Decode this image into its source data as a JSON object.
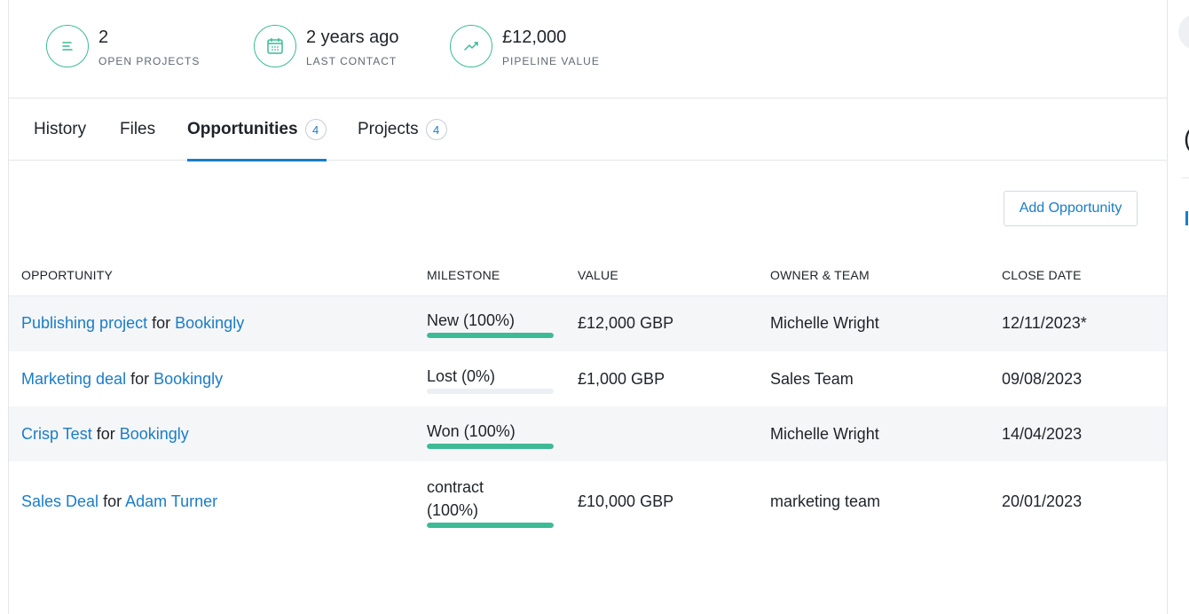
{
  "stats": [
    {
      "value": "2",
      "label": "OPEN PROJECTS",
      "icon": "lines-icon"
    },
    {
      "value": "2 years ago",
      "label": "LAST CONTACT",
      "icon": "calendar-icon"
    },
    {
      "value": "£12,000",
      "label": "PIPELINE VALUE",
      "icon": "trend-icon"
    }
  ],
  "tabs": [
    {
      "label": "History",
      "count": null
    },
    {
      "label": "Files",
      "count": null
    },
    {
      "label": "Opportunities",
      "count": "4"
    },
    {
      "label": "Projects",
      "count": "4"
    }
  ],
  "add_button": "Add Opportunity",
  "table": {
    "headers": [
      "OPPORTUNITY",
      "MILESTONE",
      "VALUE",
      "OWNER & TEAM",
      "CLOSE DATE"
    ],
    "rows": [
      {
        "name": "Publishing project",
        "for": "for",
        "org": "Bookingly",
        "milestone_line1": "New (100%)",
        "milestone_line2": "",
        "progress": 1.0,
        "value": "£12,000 GBP",
        "owner": "Michelle Wright",
        "close": "12/11/2023*"
      },
      {
        "name": "Marketing deal",
        "for": "for",
        "org": "Bookingly",
        "milestone_line1": "Lost (0%)",
        "milestone_line2": "",
        "progress": 0.0,
        "value": "£1,000 GBP",
        "owner": "Sales Team",
        "close": "09/08/2023"
      },
      {
        "name": "Crisp Test",
        "for": "for",
        "org": "Bookingly",
        "milestone_line1": "Won (100%)",
        "milestone_line2": "",
        "progress": 1.0,
        "value": "",
        "owner": "Michelle Wright",
        "close": "14/04/2023"
      },
      {
        "name": "Sales Deal",
        "for": "for",
        "org": "Adam Turner",
        "milestone_line1": "contract",
        "milestone_line2": "(100%)",
        "progress": 1.0,
        "value": "£10,000 GBP",
        "owner": "marketing team",
        "close": "20/01/2023"
      }
    ]
  },
  "right_panel": {
    "letter": "("
  },
  "colors": {
    "accent": "#1a7cc9",
    "progress": "#3dba96",
    "row_shade": "#f5f6f8"
  }
}
